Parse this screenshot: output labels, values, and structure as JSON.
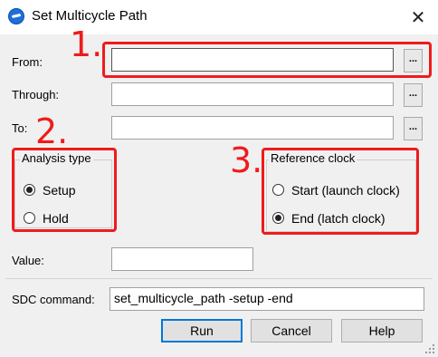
{
  "window": {
    "title": "Set Multicycle Path",
    "close_glyph": "✕",
    "icon": "app-logo-icon"
  },
  "fields": {
    "from_label": "From:",
    "through_label": "Through:",
    "to_label": "To:",
    "from_value": "",
    "through_value": "",
    "to_value": "",
    "browse_label": "...",
    "value_label": "Value:",
    "value_value": ""
  },
  "analysis_type": {
    "title": "Analysis type",
    "options": [
      {
        "label": "Setup",
        "checked": true
      },
      {
        "label": "Hold",
        "checked": false
      }
    ]
  },
  "reference_clock": {
    "title": "Reference clock",
    "options": [
      {
        "label": "Start (launch clock)",
        "checked": false
      },
      {
        "label": "End (latch clock)",
        "checked": true
      }
    ]
  },
  "sdc": {
    "label": "SDC command:",
    "value": "set_multicycle_path -setup -end"
  },
  "buttons": {
    "run": "Run",
    "cancel": "Cancel",
    "help": "Help"
  },
  "annotations": {
    "one": "1.",
    "two": "2.",
    "three": "3.",
    "color": "#ee1c1c"
  }
}
